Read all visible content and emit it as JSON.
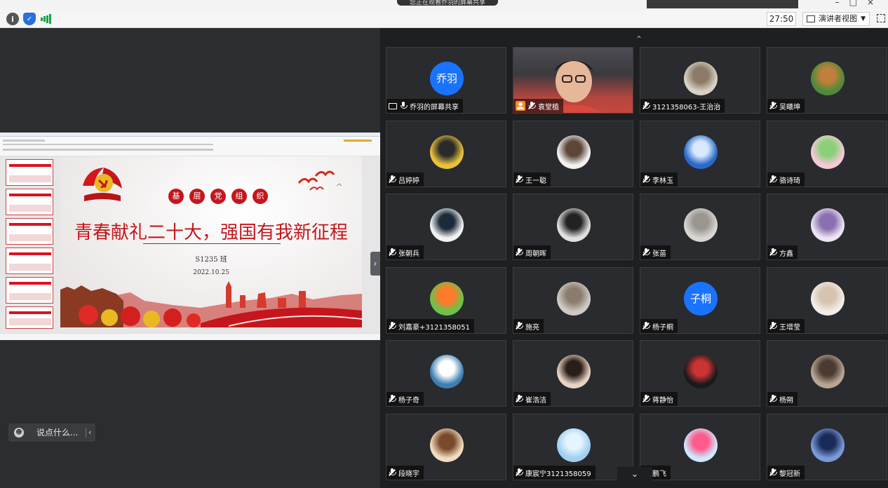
{
  "topbar": {
    "notice_text": "您正在观看乔羽的屏幕共享",
    "window_controls": [
      "minimize-icon",
      "maximize-icon",
      "close-icon"
    ]
  },
  "toolbar": {
    "timer": "27:50",
    "view_label": "演讲者视图",
    "icons": [
      "info-icon",
      "shield-icon",
      "signal-icon",
      "fullscreen-icon"
    ]
  },
  "slide": {
    "badges": [
      "基",
      "层",
      "党",
      "组",
      "织"
    ],
    "title": "青春献礼二十大，强国有我新征程",
    "class_label": "S1235 班",
    "date": "2022.10.25",
    "colors": {
      "party_red": "#c4161c"
    }
  },
  "chat": {
    "placeholder": "说点什么..."
  },
  "participants": [
    {
      "name": "乔羽的屏幕共享",
      "avatar_text": "乔羽",
      "type": "text",
      "status": "screen-share"
    },
    {
      "name": "袁堂植",
      "avatar_text": "",
      "type": "video",
      "status": "presenter"
    },
    {
      "name": "3121358063-王治治",
      "avatar_text": "",
      "type": "photo",
      "status": "muted"
    },
    {
      "name": "吴曦坤",
      "avatar_text": "",
      "type": "photo",
      "status": "muted"
    },
    {
      "name": "吕婷婷",
      "avatar_text": "",
      "type": "photo",
      "status": "muted"
    },
    {
      "name": "王一聪",
      "avatar_text": "",
      "type": "photo",
      "status": "muted"
    },
    {
      "name": "李林玉",
      "avatar_text": "",
      "type": "photo",
      "status": "muted"
    },
    {
      "name": "骆诗琦",
      "avatar_text": "",
      "type": "photo",
      "status": "muted"
    },
    {
      "name": "张朝兵",
      "avatar_text": "",
      "type": "photo",
      "status": "muted"
    },
    {
      "name": "周朝晖",
      "avatar_text": "",
      "type": "photo",
      "status": "muted"
    },
    {
      "name": "张苗",
      "avatar_text": "",
      "type": "photo",
      "status": "muted"
    },
    {
      "name": "方鑫",
      "avatar_text": "",
      "type": "photo",
      "status": "muted"
    },
    {
      "name": "刘嘉豪+3121358051",
      "avatar_text": "",
      "type": "photo",
      "status": "muted"
    },
    {
      "name": "施亮",
      "avatar_text": "",
      "type": "photo",
      "status": "muted"
    },
    {
      "name": "杨子桐",
      "avatar_text": "子桐",
      "type": "text",
      "status": "muted"
    },
    {
      "name": "王增莹",
      "avatar_text": "",
      "type": "photo",
      "status": "muted"
    },
    {
      "name": "杨子奇",
      "avatar_text": "",
      "type": "photo",
      "status": "muted"
    },
    {
      "name": "崔浩洁",
      "avatar_text": "",
      "type": "photo",
      "status": "muted"
    },
    {
      "name": "蒋静怡",
      "avatar_text": "",
      "type": "photo",
      "status": "muted"
    },
    {
      "name": "杨朔",
      "avatar_text": "",
      "type": "photo",
      "status": "muted"
    },
    {
      "name": "段晓宇",
      "avatar_text": "",
      "type": "photo",
      "status": "muted"
    },
    {
      "name": "康宸宁3121358059",
      "avatar_text": "",
      "type": "photo",
      "status": "muted"
    },
    {
      "name": "鹏飞",
      "avatar_text": "",
      "type": "photo",
      "status": "muted"
    },
    {
      "name": "黎冠新",
      "avatar_text": "",
      "type": "photo",
      "status": "muted"
    }
  ]
}
